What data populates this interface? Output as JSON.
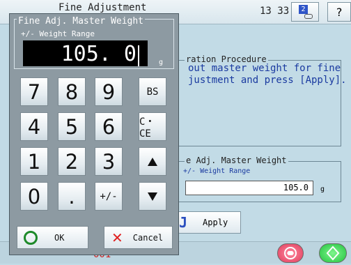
{
  "topbar": {
    "title": "Fine Adjustment",
    "time": "13 33",
    "badge": "2",
    "help_glyph": "?"
  },
  "procedure": {
    "legend": "ration Procedure",
    "text_line1": "out master weight for fine",
    "text_line2": "justment and press [Apply]."
  },
  "master_weight": {
    "legend": "e Adj. Master Weight",
    "sub": "+/- Weight Range",
    "value": "105.0",
    "unit": "g"
  },
  "apply": {
    "glyph": "J",
    "label": "Apply"
  },
  "status": {
    "counter": "001"
  },
  "dialog": {
    "title": "Fine Adj. Master Weight",
    "sub": "+/- Weight Range",
    "display_value": "105. 0",
    "unit": "g",
    "keys": {
      "k7": "7",
      "k8": "8",
      "k9": "9",
      "bs": "BS",
      "k4": "4",
      "k5": "5",
      "k6": "6",
      "cce": "C・CE",
      "k1": "1",
      "k2": "2",
      "k3": "3",
      "k0": "0",
      "dot": ".",
      "pm": "+/-"
    },
    "ok_label": "OK",
    "cancel_label": "Cancel"
  },
  "colors": {
    "background": "#c2dbe6",
    "dialog": "#8d9aa2",
    "accent_text": "#1a3aa0",
    "ok_green": "#1d8a2a",
    "cancel_red": "#e02020"
  }
}
